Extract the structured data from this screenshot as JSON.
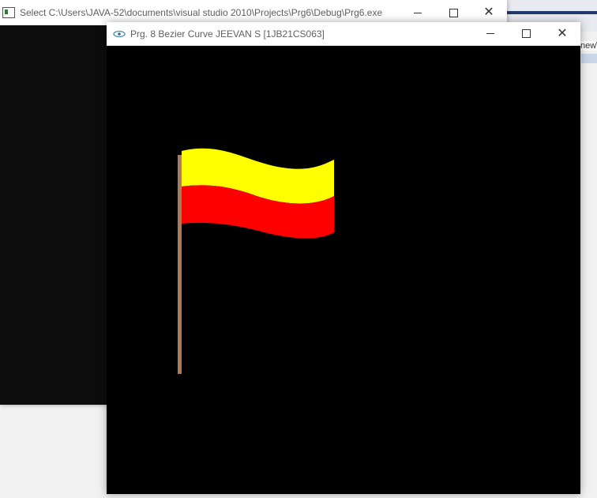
{
  "console_window": {
    "title": "Select C:\\Users\\JAVA-52\\documents\\visual studio 2010\\Projects\\Prg6\\Debug\\Prg6.exe"
  },
  "glut_window": {
    "title": "Prg. 8 Bezier Curve JEEVAN S [1JB21CS063]"
  },
  "background_app": {
    "partial_text": "new\\"
  },
  "flag": {
    "top_color": "#ffff00",
    "bottom_color": "#ff0000",
    "pole_color": "#b07a54"
  },
  "icons": {
    "console": "console-app-icon",
    "glut": "glut-eye-icon",
    "minimize": "minimize-icon",
    "maximize": "maximize-icon",
    "close": "close-icon"
  }
}
